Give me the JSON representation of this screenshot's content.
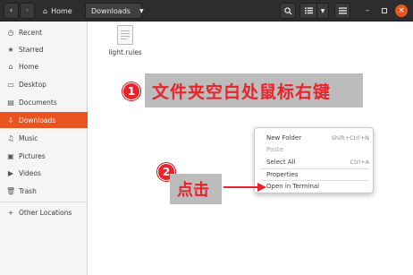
{
  "header": {
    "back_icon": "chevron-left-icon",
    "forward_icon": "chevron-right-icon",
    "home_label": "Home",
    "current_label": "Downloads",
    "window_controls": [
      "minimize",
      "maximize",
      "close"
    ]
  },
  "sidebar": {
    "items": [
      {
        "label": "Recent",
        "icon": "clock-icon"
      },
      {
        "label": "Starred",
        "icon": "star-icon"
      },
      {
        "label": "Home",
        "icon": "home-icon"
      },
      {
        "label": "Desktop",
        "icon": "desktop-icon"
      },
      {
        "label": "Documents",
        "icon": "document-icon"
      },
      {
        "label": "Downloads",
        "icon": "download-icon",
        "selected": true
      },
      {
        "label": "Music",
        "icon": "music-icon"
      },
      {
        "label": "Pictures",
        "icon": "picture-icon"
      },
      {
        "label": "Videos",
        "icon": "video-icon"
      },
      {
        "label": "Trash",
        "icon": "trash-icon"
      },
      {
        "label": "Other Locations",
        "icon": "plus-icon"
      }
    ]
  },
  "files": [
    {
      "name": "light.rules"
    }
  ],
  "annotations": {
    "step1_number": "1",
    "step1_text": "文件夹空白处鼠标右键",
    "step2_number": "2",
    "step2_text": "点击"
  },
  "context_menu": {
    "items": [
      {
        "label": "New Folder",
        "accel": "Shift+Ctrl+N",
        "disabled": false
      },
      {
        "label": "Paste",
        "accel": "",
        "disabled": true
      },
      {
        "label": "Select All",
        "accel": "Ctrl+A",
        "disabled": false
      },
      {
        "label": "Properties",
        "accel": "",
        "disabled": false
      },
      {
        "label": "Open in Terminal",
        "accel": "",
        "disabled": false
      }
    ]
  },
  "colors": {
    "accent": "#e95420",
    "annotation_red": "#e8232a",
    "callout_bg": "#bcbcbc",
    "headerbar_bg": "#2d2d2d"
  }
}
